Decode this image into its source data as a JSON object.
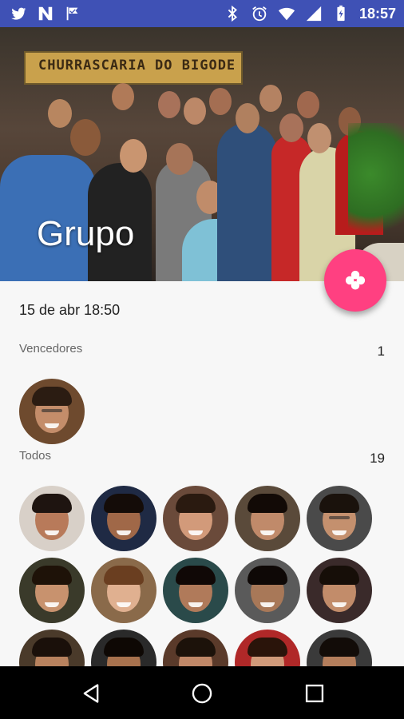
{
  "status_bar": {
    "time": "18:57",
    "left_icons": [
      "twitter-icon",
      "n-app-icon",
      "check-flag-icon"
    ],
    "right_icons": [
      "bluetooth-icon",
      "alarm-icon",
      "wifi-icon",
      "signal-icon",
      "battery-icon"
    ],
    "color": "#3f51b5"
  },
  "header": {
    "title": "Grupo",
    "photo_sign_text": "CHURRASCARIA DO BIGODE"
  },
  "content": {
    "date": "15 de abr 18:50",
    "winners": {
      "label": "Vencedores",
      "count": "1"
    },
    "all": {
      "label": "Todos",
      "count": "19"
    }
  },
  "fab": {
    "icon": "clover-icon",
    "color": "#ff4081"
  },
  "nav_bar": {
    "buttons": [
      "back-icon",
      "home-icon",
      "recents-icon"
    ]
  }
}
